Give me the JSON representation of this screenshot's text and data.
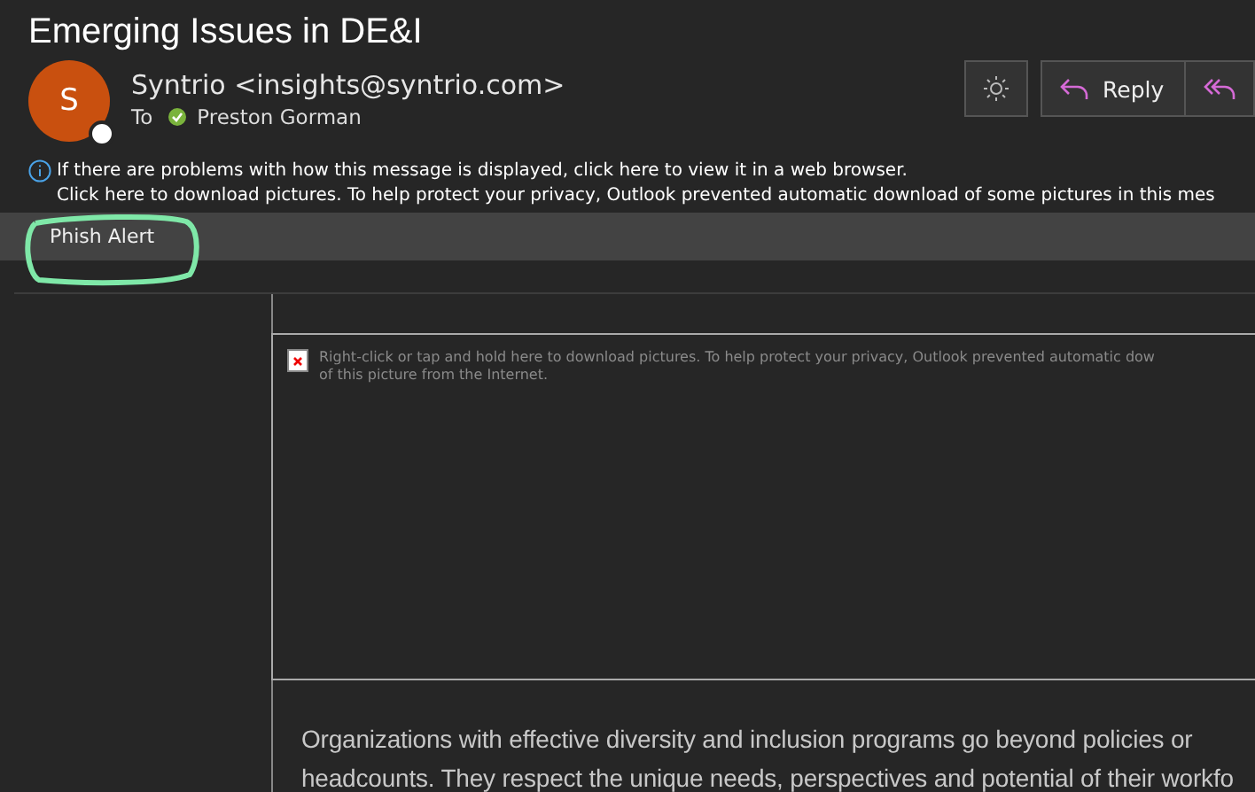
{
  "message": {
    "subject": "Emerging Issues in DE&I",
    "avatar_initial": "S",
    "sender": "Syntrio <insights@syntrio.com>",
    "to_label": "To",
    "recipient": "Preston Gorman"
  },
  "actions": [
    {
      "kind": "theme"
    },
    {
      "kind": "reply",
      "label": "Reply"
    },
    {
      "kind": "reply_all"
    }
  ],
  "notices": [
    "If there are problems with how this message is displayed, click here to view it in a web browser.",
    "Click here to download pictures. To help protect your privacy, Outlook prevented automatic download of some pictures in this mes"
  ],
  "addin_bar": {
    "label": "Phish Alert"
  },
  "blocked_image": {
    "text": "Right-click or tap and hold here to download pictures. To help protect your privacy, Outlook prevented automatic dow",
    "text_line2": "of this picture from the Internet."
  },
  "body": [
    "Organizations with effective diversity and inclusion programs go beyond policies or",
    "headcounts. They respect the unique needs, perspectives and potential of their workfo"
  ]
}
